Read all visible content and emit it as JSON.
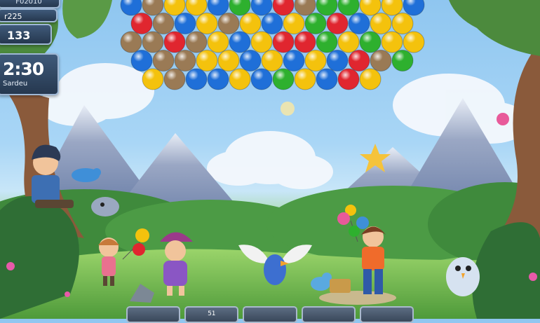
{
  "hud": {
    "top_value": "F02010",
    "coins": "r225",
    "score": "133",
    "timer": "2:30",
    "timer_label": "Sardeu"
  },
  "tray": {
    "slots": [
      "",
      "51",
      "",
      "",
      ""
    ]
  },
  "bubbles": [
    [
      "blue",
      "brown",
      "yellow",
      "yellow",
      "blue",
      "green",
      "blue",
      "red",
      "brown",
      "green",
      "green",
      "yellow",
      "yellow",
      "blue"
    ],
    [
      "red",
      "brown",
      "blue",
      "yellow",
      "brown",
      "yellow",
      "blue",
      "yellow",
      "green",
      "red",
      "blue",
      "yellow",
      "yellow"
    ],
    [
      "brown",
      "brown",
      "red",
      "brown",
      "yellow",
      "blue",
      "yellow",
      "red",
      "red",
      "green",
      "yellow",
      "green",
      "yellow",
      "yellow"
    ],
    [
      "blue",
      "brown",
      "brown",
      "yellow",
      "yellow",
      "blue",
      "yellow",
      "blue",
      "yellow",
      "blue",
      "red",
      "brown",
      "green"
    ],
    [
      "yellow",
      "brown",
      "blue",
      "blue",
      "yellow",
      "blue",
      "green",
      "yellow",
      "blue",
      "red",
      "yellow"
    ]
  ],
  "colors": {
    "red": "#e0262f",
    "blue": "#1f6fd8",
    "yellow": "#f4c20d",
    "green": "#2eb02e",
    "brown": "#9a7a55"
  }
}
